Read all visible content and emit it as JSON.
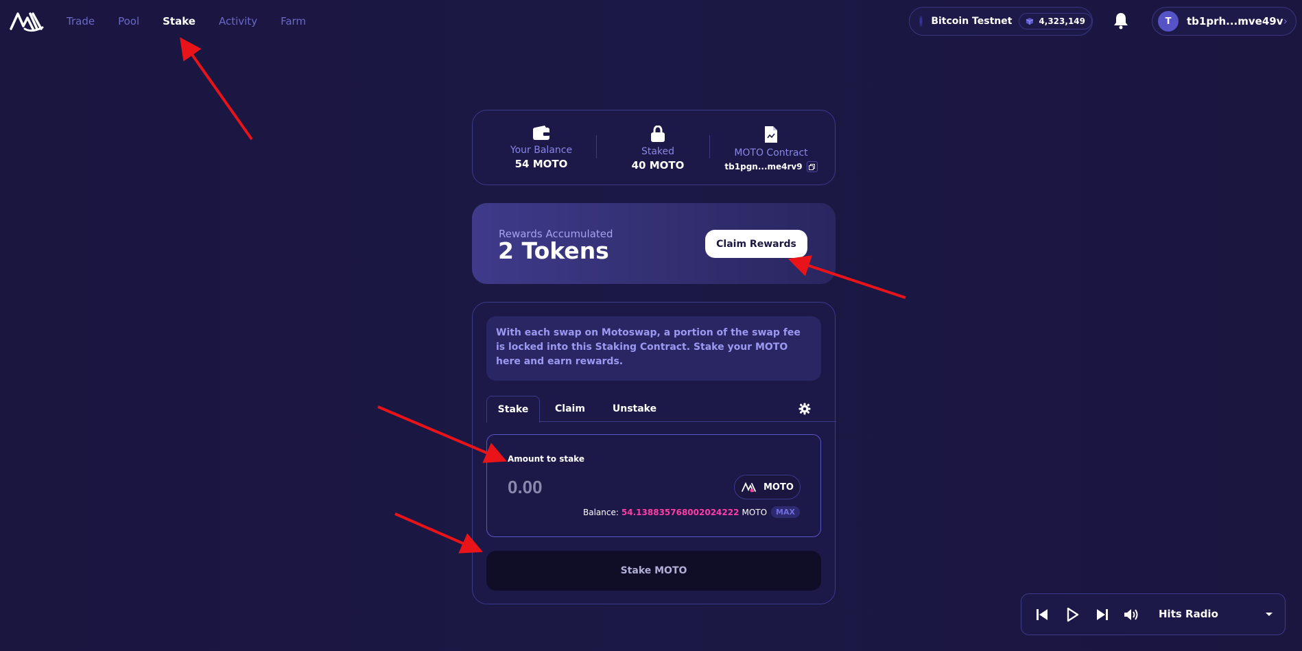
{
  "nav": {
    "items": [
      {
        "label": "Trade",
        "active": false
      },
      {
        "label": "Pool",
        "active": false
      },
      {
        "label": "Stake",
        "active": true
      },
      {
        "label": "Activity",
        "active": false
      },
      {
        "label": "Farm",
        "active": false
      }
    ]
  },
  "header": {
    "network_name": "Bitcoin Testnet",
    "block_number": "4,323,149",
    "account_initial": "T",
    "account_address": "tb1prh...mve49v",
    "icons": {
      "logo": "motoswap-logo",
      "block": "cube-icon",
      "bell": "bell-icon",
      "chevron": "chevron-right-icon"
    }
  },
  "stats": {
    "balance_label": "Your Balance",
    "balance_value": "54 MOTO",
    "staked_label": "Staked",
    "staked_value": "40 MOTO",
    "contract_label": "MOTO Contract",
    "contract_address": "tb1pgn...me4rv9"
  },
  "rewards": {
    "label": "Rewards Accumulated",
    "value": "2 Tokens",
    "claim_button": "Claim Rewards"
  },
  "stake": {
    "info_text": "With each swap on Motoswap, a portion of the swap fee is locked into this Staking Contract. Stake your MOTO here and earn rewards.",
    "tabs": [
      "Stake",
      "Claim",
      "Unstake"
    ],
    "active_tab": "Stake",
    "amount_label": "Amount to stake",
    "amount_placeholder": "0.00",
    "token_name": "MOTO",
    "balance_label": "Balance:",
    "balance_value": "54.138835768002024222",
    "balance_unit": "MOTO",
    "max_label": "MAX",
    "submit_button": "Stake MOTO"
  },
  "player": {
    "station": "Hits Radio"
  },
  "colors": {
    "background": "#1a1640",
    "card": "#1c1848",
    "accent": "#6b68c8",
    "balance_highlight": "#ff3ea5",
    "annotation": "#e8141a"
  }
}
